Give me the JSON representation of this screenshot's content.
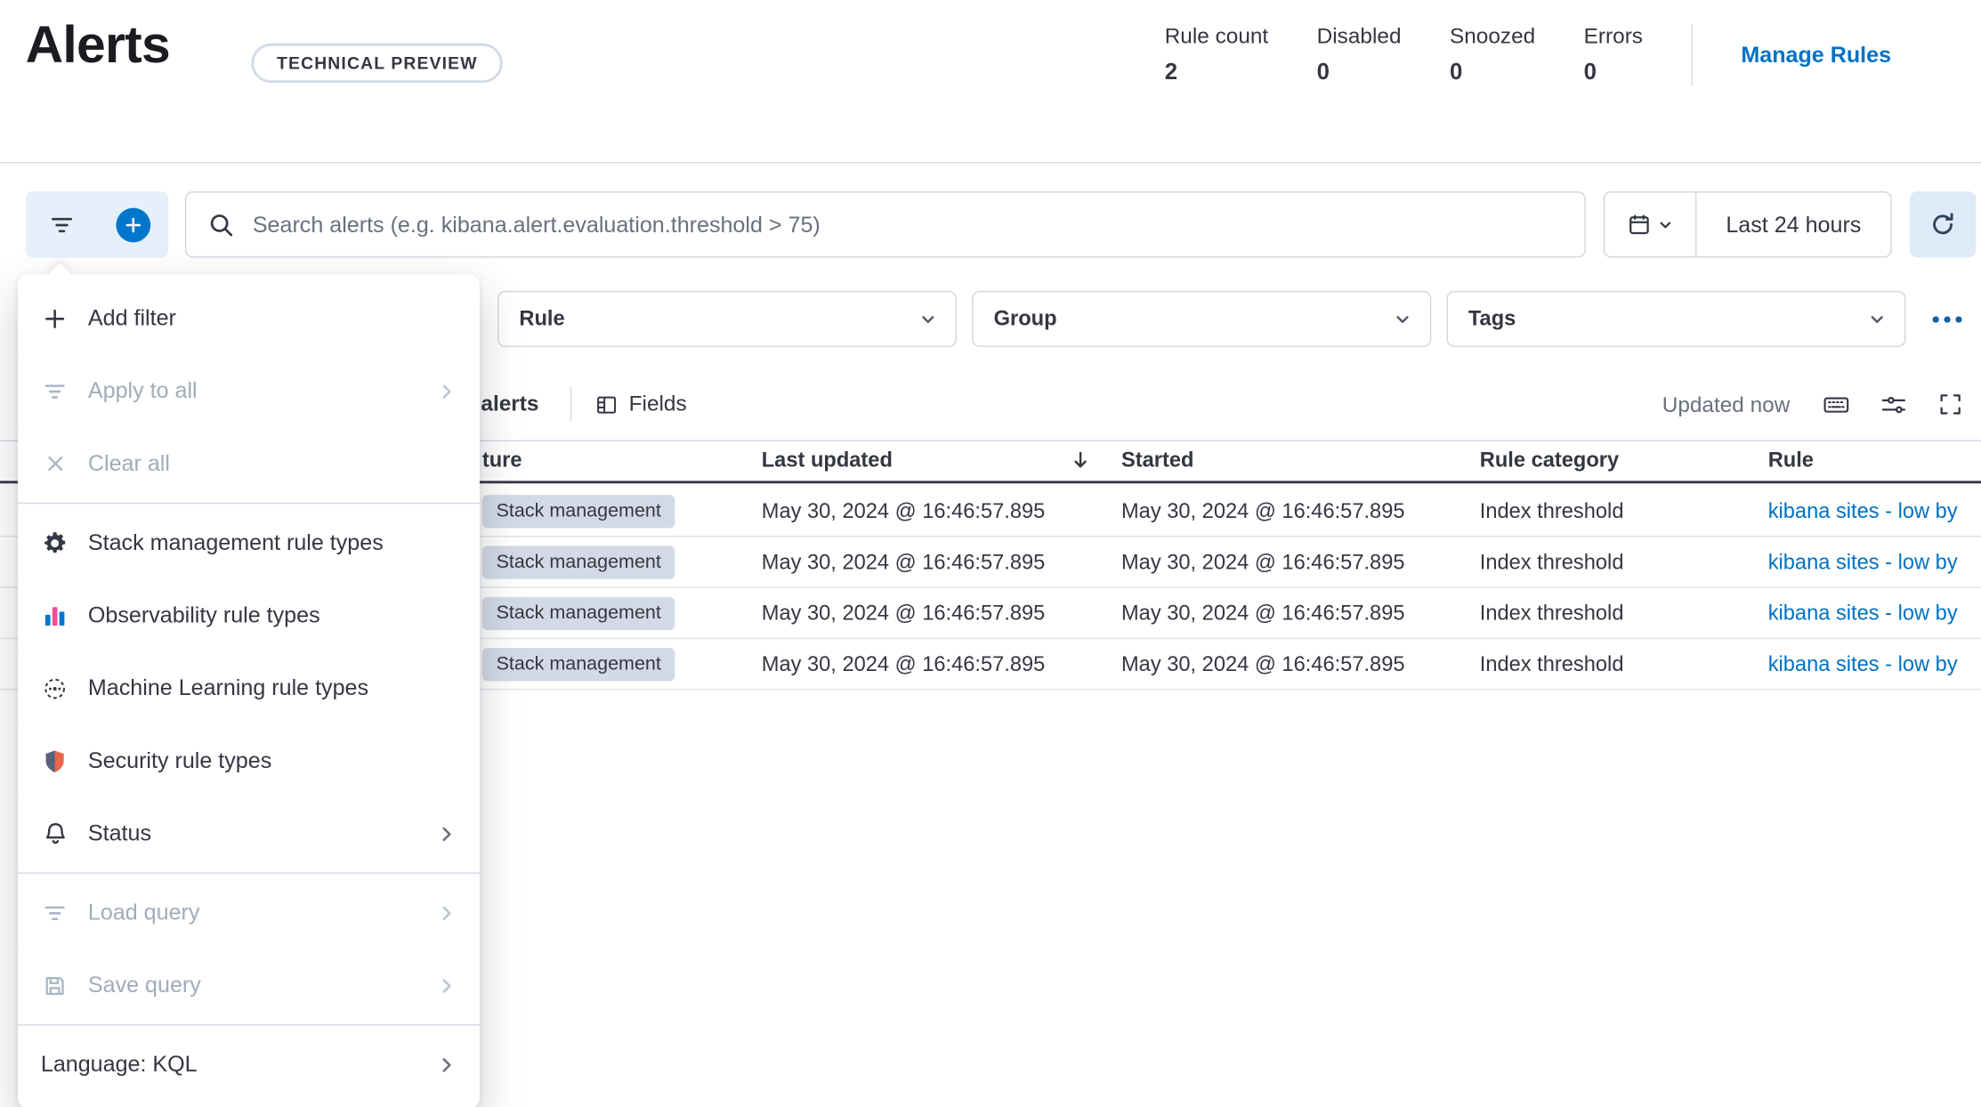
{
  "page": {
    "title": "Alerts",
    "badge": "TECHNICAL PREVIEW"
  },
  "stats": {
    "items": [
      {
        "label": "Rule count",
        "value": "2"
      },
      {
        "label": "Disabled",
        "value": "0"
      },
      {
        "label": "Snoozed",
        "value": "0"
      },
      {
        "label": "Errors",
        "value": "0"
      }
    ],
    "manage_rules": "Manage Rules"
  },
  "toolbar": {
    "search_placeholder": "Search alerts (e.g. kibana.alert.evaluation.threshold > 75)",
    "time_range": "Last 24 hours"
  },
  "filter_bar": {
    "rule": "Rule",
    "group": "Group",
    "tags": "Tags"
  },
  "filter_menu": {
    "items": [
      {
        "label": "Add filter",
        "icon": "plus-icon",
        "disabled": false,
        "arrow": false
      },
      {
        "label": "Apply to all",
        "icon": "filter-icon",
        "disabled": true,
        "arrow": true
      },
      {
        "label": "Clear all",
        "icon": "cross-icon",
        "disabled": true,
        "arrow": false
      },
      {
        "label": "Stack management rule types",
        "icon": "gear-icon",
        "disabled": false,
        "arrow": false
      },
      {
        "label": "Observability rule types",
        "icon": "observability-icon",
        "disabled": false,
        "arrow": false
      },
      {
        "label": "Machine Learning rule types",
        "icon": "machine-learning-icon",
        "disabled": false,
        "arrow": false
      },
      {
        "label": "Security rule types",
        "icon": "security-icon",
        "disabled": false,
        "arrow": false
      },
      {
        "label": "Status",
        "icon": "bell-icon",
        "disabled": false,
        "arrow": true
      },
      {
        "label": "Load query",
        "icon": "filter-icon",
        "disabled": true,
        "arrow": true
      },
      {
        "label": "Save query",
        "icon": "save-icon",
        "disabled": true,
        "arrow": true
      },
      {
        "label": "Language: KQL",
        "icon": null,
        "disabled": false,
        "arrow": true
      }
    ]
  },
  "status_bar": {
    "alerts_label": "alerts",
    "fields_label": "Fields",
    "updated_label": "Updated now"
  },
  "table": {
    "columns": [
      "ture",
      "Last updated",
      "Started",
      "Rule category",
      "Rule"
    ],
    "rows": [
      {
        "feature": "Stack management",
        "last_updated": "May 30, 2024 @ 16:46:57.895",
        "started": "May 30, 2024 @ 16:46:57.895",
        "rule_category": "Index threshold",
        "rule": "kibana sites - low by"
      },
      {
        "feature": "Stack management",
        "last_updated": "May 30, 2024 @ 16:46:57.895",
        "started": "May 30, 2024 @ 16:46:57.895",
        "rule_category": "Index threshold",
        "rule": "kibana sites - low by"
      },
      {
        "feature": "Stack management",
        "last_updated": "May 30, 2024 @ 16:46:57.895",
        "started": "May 30, 2024 @ 16:46:57.895",
        "rule_category": "Index threshold",
        "rule": "kibana sites - low by"
      },
      {
        "feature": "Stack management",
        "last_updated": "May 30, 2024 @ 16:46:57.895",
        "started": "May 30, 2024 @ 16:46:57.895",
        "rule_category": "Index threshold",
        "rule": "kibana sites - low by"
      }
    ]
  },
  "colors": {
    "accent": "#0077cc",
    "link": "#0071c2",
    "badge_bg": "#d3dae6",
    "disabled_text": "#a2abba",
    "border": "#d3dae6"
  },
  "icons": {
    "filter": "funnel-lines",
    "plus-in-circle": "filled-blue-circle-plus",
    "search": "magnifier",
    "calendar": "calendar",
    "chevron-down": "chevron-down",
    "refresh": "circular-arrow",
    "boxes-horizontal": "three-dots",
    "fields": "table-columns",
    "keyboard": "keyboard",
    "controls": "sliders",
    "fullscreen": "expand-corners",
    "sort-down": "arrow-down",
    "plus": "plus",
    "cross": "x",
    "gear": "gear",
    "observability": "colored-bars",
    "machine-learning": "dotted-node-circle",
    "security": "two-tone-shield",
    "bell": "bell",
    "save": "floppy-disk",
    "chevron-right": "chevron-right"
  }
}
